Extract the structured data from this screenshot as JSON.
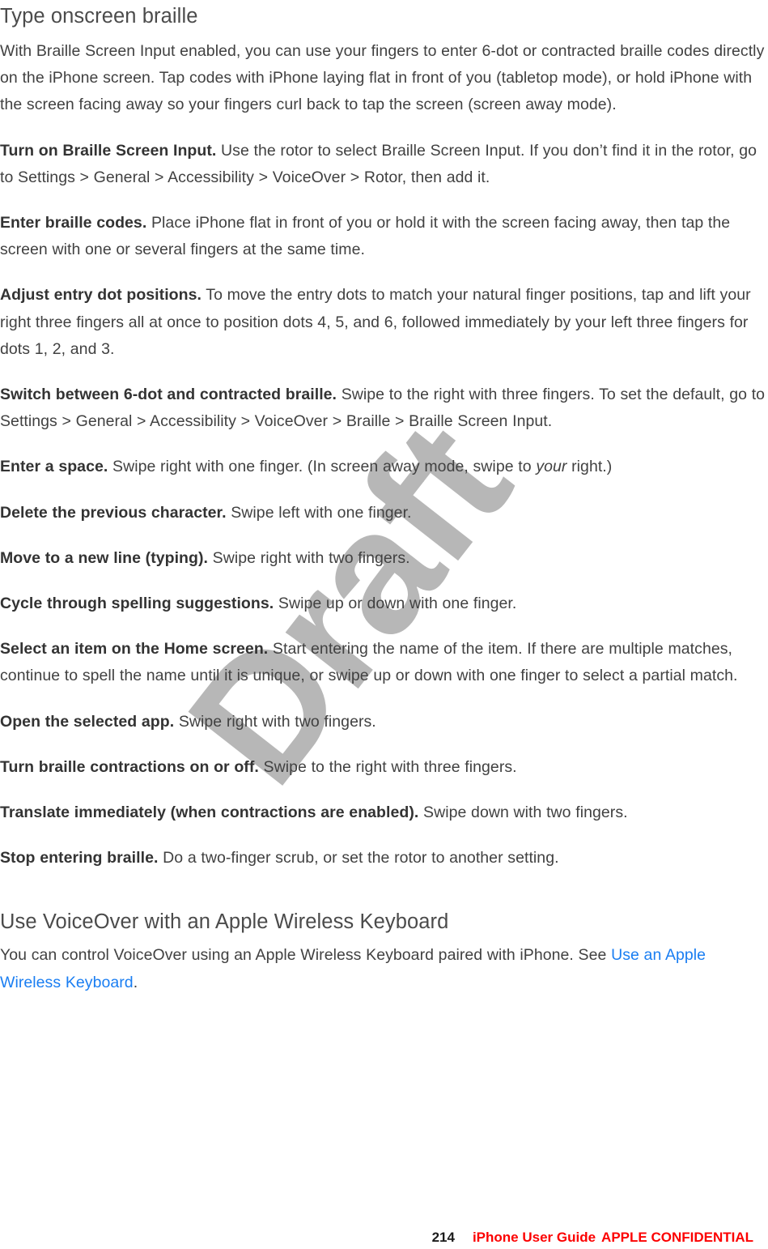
{
  "document": {
    "heading_1": "Type onscreen braille",
    "heading_2": "Use VoiceOver with an Apple Wireless Keyboard",
    "watermark": "Draft",
    "link_color": "#1a7ef2",
    "confidential_color": "#fc0000",
    "body_color": "#414141",
    "heading_color": "#4b4b4b"
  },
  "intro": {
    "text": "With Braille Screen Input enabled, you can use your fingers to enter 6-dot or contracted braille codes directly on the iPhone screen. Tap codes with iPhone laying flat in front of you (tabletop mode), or hold iPhone with the screen facing away so your fingers curl back to tap the screen (screen away mode)."
  },
  "tasks": [
    {
      "lead": "Turn on Braille Screen Input.",
      "body": " Use the rotor to select Braille Screen Input. If you don’t find it in the rotor, go to Settings > General > Accessibility > VoiceOver > Rotor, then add it."
    },
    {
      "lead": "Enter braille codes.",
      "body": " Place iPhone flat in front of you or hold it with the screen facing away, then tap the screen with one or several fingers at the same time."
    },
    {
      "lead": "Adjust entry dot positions.",
      "body": " To move the entry dots to match your natural finger positions, tap and lift your right three fingers all at once to position dots 4, 5, and 6, followed immediately by your left three fingers for dots 1, 2, and 3."
    },
    {
      "lead": "Switch between 6-dot and contracted braille.",
      "body": " Swipe to the right with three fingers. To set the default, go to Settings > General > Accessibility > VoiceOver > Braille > Braille Screen Input."
    },
    {
      "lead": "Enter a space.",
      "body_pre": " Swipe right with one finger. (In screen away mode, swipe to ",
      "body_italic": "your",
      "body_post": " right.)"
    },
    {
      "lead": "Delete the previous character.",
      "body": " Swipe left with one finger."
    },
    {
      "lead": "Move to a new line (typing).",
      "body": " Swipe right with two fingers."
    },
    {
      "lead": "Cycle through spelling suggestions.",
      "body": " Swipe up or down with one finger."
    },
    {
      "lead": "Select an item on the Home screen.",
      "body": " Start entering the name of the item. If there are multiple matches, continue to spell the name until it is unique, or swipe up or down with one finger to select a partial match."
    },
    {
      "lead": "Open the selected app.",
      "body": " Swipe right with two fingers."
    },
    {
      "lead": "Turn braille contractions on or off.",
      "body": " Swipe to the right with three fingers."
    },
    {
      "lead": "Translate immediately (when contractions are enabled).",
      "body": " Swipe down with two fingers."
    },
    {
      "lead": "Stop entering braille.",
      "body": " Do a two-finger scrub, or set the rotor to another setting."
    }
  ],
  "keyboard_section": {
    "paragraph_pre": "You can control VoiceOver using an Apple Wireless Keyboard paired with iPhone. See ",
    "link_text": "Use an Apple Wireless Keyboard",
    "paragraph_post": "."
  },
  "footer": {
    "page_number": "214",
    "guide_name": "iPhone User Guide",
    "confidential": "APPLE CONFIDENTIAL"
  }
}
